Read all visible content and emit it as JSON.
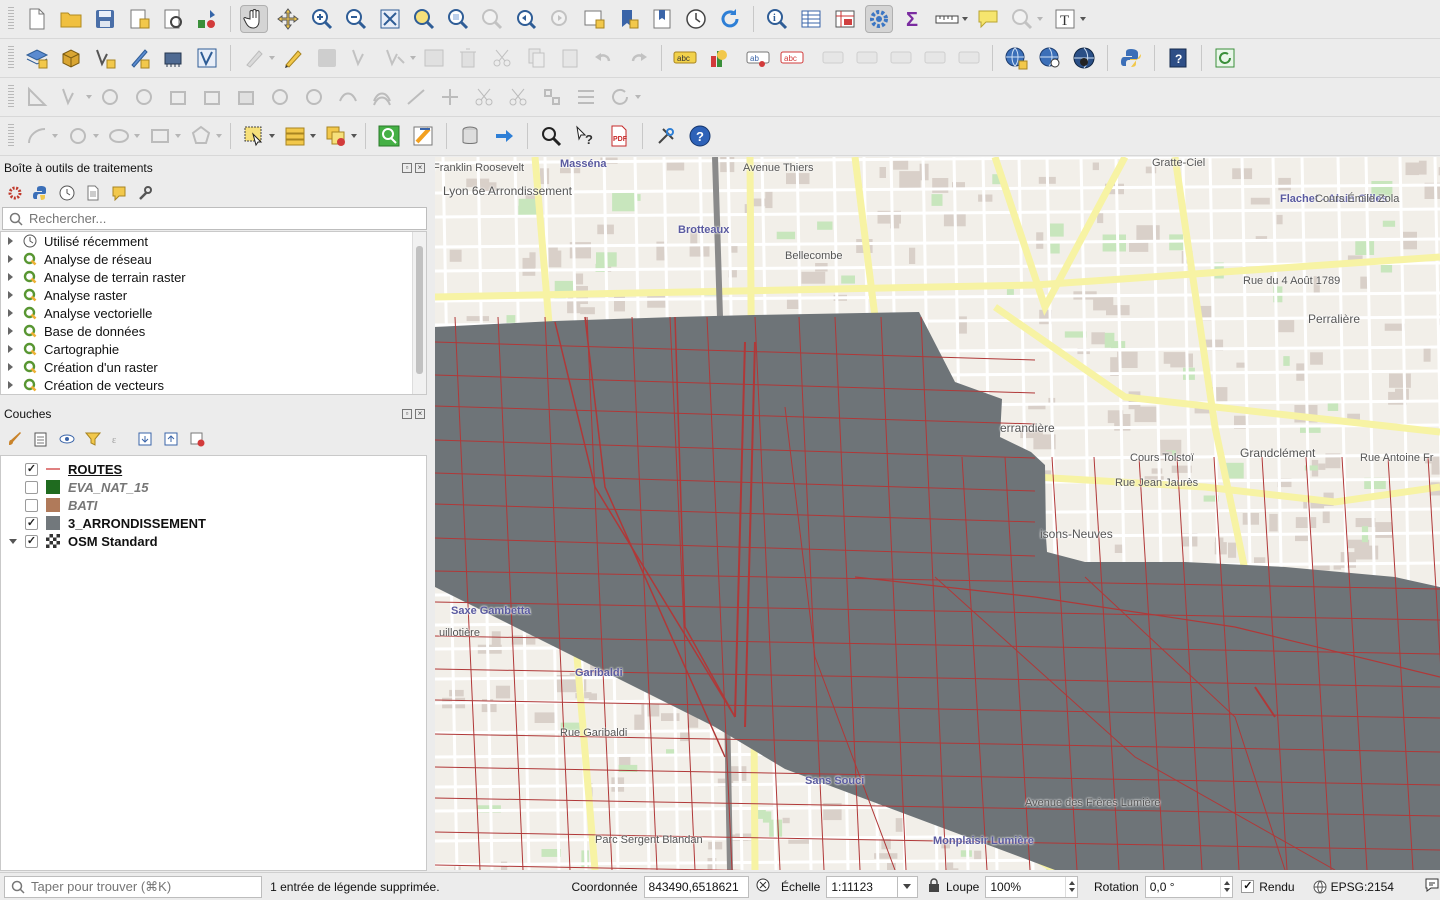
{
  "processing": {
    "title": "Boîte à outils de traitements",
    "search_placeholder": "Rechercher...",
    "items": [
      {
        "label": "Utilisé récemment",
        "icon": "clock-icon"
      },
      {
        "label": "Analyse de réseau",
        "icon": "qgis-icon"
      },
      {
        "label": "Analyse de terrain raster",
        "icon": "qgis-icon"
      },
      {
        "label": "Analyse raster",
        "icon": "qgis-icon"
      },
      {
        "label": "Analyse vectorielle",
        "icon": "qgis-icon"
      },
      {
        "label": "Base de données",
        "icon": "qgis-icon"
      },
      {
        "label": "Cartographie",
        "icon": "qgis-icon"
      },
      {
        "label": "Création d'un raster",
        "icon": "qgis-icon"
      },
      {
        "label": "Création de vecteurs",
        "icon": "qgis-icon"
      }
    ]
  },
  "layers": {
    "title": "Couches",
    "items": [
      {
        "name": "ROUTES",
        "checked": true,
        "symbol": "line",
        "color": "#e08080"
      },
      {
        "name": "EVA_NAT_15",
        "checked": false,
        "symbol": "fill",
        "color": "#1f6b1f"
      },
      {
        "name": "BATI",
        "checked": false,
        "symbol": "fill",
        "color": "#b07a5a"
      },
      {
        "name": "3_ARRONDISSEMENT",
        "checked": true,
        "symbol": "fill",
        "color": "#72787c"
      },
      {
        "name": "OSM Standard",
        "checked": true,
        "symbol": "raster",
        "color": "#555555"
      }
    ]
  },
  "map": {
    "overlay_color": "#6e7478",
    "road_color": "#b03838",
    "labels": [
      "Masséna",
      "Gratte-Ciel",
      "Lyon 6e Arrondissement",
      "Brotteaux",
      "Bellecombe",
      "Franklin Roosevelt",
      "Flachet - Alain Gilles",
      "Cours Émile Zola",
      "Rue du 4 Août 1789",
      "Perralière",
      "Cours Tolstoï",
      "errandière",
      "Grandclément",
      "Rue Jean Jaurès",
      "isons-Neuves",
      "Rue Antoine Fr",
      "Saxe Gambetta",
      "uillotière",
      "Garibaldi",
      "Sans Souci",
      "Parc Sergent Blandan",
      "Avenue des Frères Lumière",
      "Monplaisir Lumière",
      "Rue Garibaldi",
      "Avenue Thiers"
    ]
  },
  "status": {
    "locator_placeholder": "Taper pour trouver (⌘K)",
    "message": "1 entrée de légende supprimée.",
    "coord_label": "Coordonnée",
    "coord_value": "843490,6518621",
    "scale_label": "Échelle",
    "scale_value": "1:11123",
    "magnifier_label": "Loupe",
    "magnifier_value": "100%",
    "rotation_label": "Rotation",
    "rotation_value": "0,0 °",
    "render_label": "Rendu",
    "crs": "EPSG:2154"
  }
}
